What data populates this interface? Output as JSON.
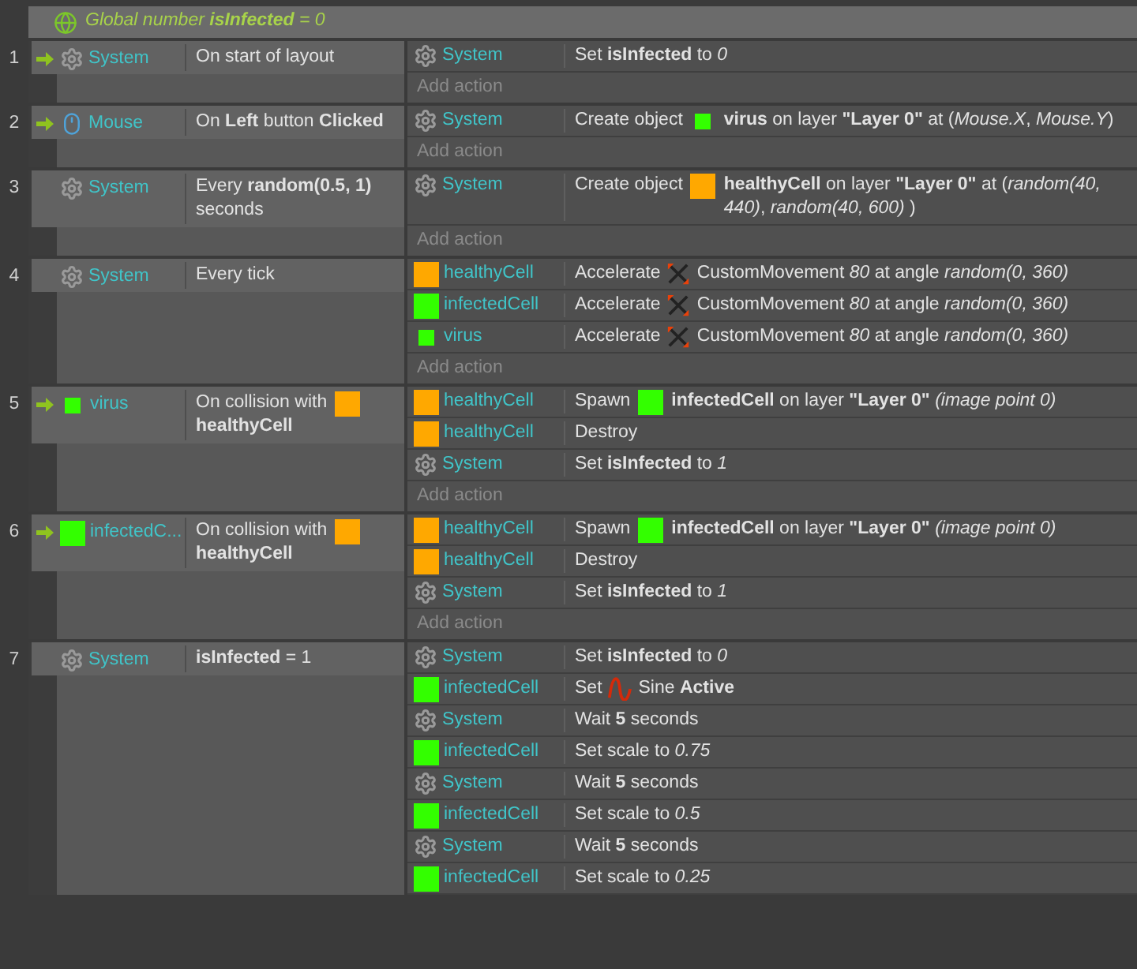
{
  "global_variable": {
    "text": "Global number **isInfected** = 0"
  },
  "events": [
    {
      "number": "1",
      "conditions": [
        {
          "trigger": true,
          "object": {
            "kind": "gear",
            "name": "System"
          },
          "parts": [
            {
              "kind": "text",
              "text": "On start of layout"
            }
          ]
        }
      ],
      "actions": [
        {
          "object": {
            "kind": "gear",
            "name": "System"
          },
          "parts": [
            {
              "kind": "text",
              "text": "Set **isInfected** to *0*"
            }
          ]
        }
      ],
      "add_action": "Add action"
    },
    {
      "number": "2",
      "conditions": [
        {
          "trigger": true,
          "object": {
            "kind": "mouse",
            "name": "Mouse"
          },
          "parts": [
            {
              "kind": "text",
              "text": "On **Left** button **Clicked**"
            }
          ]
        }
      ],
      "actions": [
        {
          "object": {
            "kind": "gear",
            "name": "System"
          },
          "parts": [
            {
              "kind": "text",
              "text": "Create object"
            },
            {
              "kind": "sprite-small",
              "color": "#33ff00"
            },
            {
              "kind": "text",
              "text": "**virus** on layer **\"Layer 0\"** at (*Mouse.X*, *Mouse.Y*)"
            }
          ]
        }
      ],
      "add_action": "Add action"
    },
    {
      "number": "3",
      "conditions": [
        {
          "trigger": false,
          "object": {
            "kind": "gear",
            "name": "System"
          },
          "parts": [
            {
              "kind": "text",
              "text": "Every **random(0.5, 1)** seconds"
            }
          ]
        }
      ],
      "actions": [
        {
          "object": {
            "kind": "gear",
            "name": "System"
          },
          "parts": [
            {
              "kind": "text",
              "text": "Create object"
            },
            {
              "kind": "sprite",
              "color": "#ffa800"
            },
            {
              "kind": "text",
              "text": "**healthyCell** on layer **\"Layer 0\"** at (*random(40, 440)*, *random(40, 600)* )"
            }
          ]
        }
      ],
      "add_action": "Add action"
    },
    {
      "number": "4",
      "conditions": [
        {
          "trigger": false,
          "object": {
            "kind": "gear",
            "name": "System"
          },
          "parts": [
            {
              "kind": "text",
              "text": "Every tick"
            }
          ]
        }
      ],
      "actions": [
        {
          "object": {
            "kind": "sprite",
            "color": "#ffa800",
            "name": "healthyCell"
          },
          "parts": [
            {
              "kind": "text",
              "text": "Accelerate"
            },
            {
              "kind": "movement"
            },
            {
              "kind": "text",
              "text": "CustomMovement *80* at angle *random(0, 360)*"
            }
          ]
        },
        {
          "object": {
            "kind": "sprite",
            "color": "#33ff00",
            "name": "infectedCell"
          },
          "parts": [
            {
              "kind": "text",
              "text": "Accelerate"
            },
            {
              "kind": "movement"
            },
            {
              "kind": "text",
              "text": "CustomMovement *80* at angle *random(0, 360)*"
            }
          ]
        },
        {
          "object": {
            "kind": "sprite-small",
            "color": "#33ff00",
            "name": "virus"
          },
          "parts": [
            {
              "kind": "text",
              "text": "Accelerate"
            },
            {
              "kind": "movement"
            },
            {
              "kind": "text",
              "text": "CustomMovement *80* at angle *random(0, 360)*"
            }
          ]
        }
      ],
      "add_action": "Add action"
    },
    {
      "number": "5",
      "conditions": [
        {
          "trigger": true,
          "object": {
            "kind": "sprite-small",
            "color": "#33ff00",
            "name": "virus"
          },
          "parts": [
            {
              "kind": "text",
              "text": "On collision with"
            },
            {
              "kind": "sprite",
              "color": "#ffa800"
            },
            {
              "kind": "text",
              "text": "**healthyCell**"
            }
          ]
        }
      ],
      "actions": [
        {
          "object": {
            "kind": "sprite",
            "color": "#ffa800",
            "name": "healthyCell"
          },
          "parts": [
            {
              "kind": "text",
              "text": "Spawn"
            },
            {
              "kind": "sprite",
              "color": "#33ff00"
            },
            {
              "kind": "text",
              "text": "**infectedCell** on layer **\"Layer 0\"** *(image point 0)*"
            }
          ]
        },
        {
          "object": {
            "kind": "sprite",
            "color": "#ffa800",
            "name": "healthyCell"
          },
          "parts": [
            {
              "kind": "text",
              "text": "Destroy"
            }
          ]
        },
        {
          "object": {
            "kind": "gear",
            "name": "System"
          },
          "parts": [
            {
              "kind": "text",
              "text": "Set **isInfected** to *1*"
            }
          ]
        }
      ],
      "add_action": "Add action"
    },
    {
      "number": "6",
      "conditions": [
        {
          "trigger": true,
          "object": {
            "kind": "sprite",
            "color": "#33ff00",
            "name": "infectedC..."
          },
          "parts": [
            {
              "kind": "text",
              "text": "On collision with"
            },
            {
              "kind": "sprite",
              "color": "#ffa800"
            },
            {
              "kind": "text",
              "text": "**healthyCell**"
            }
          ]
        }
      ],
      "actions": [
        {
          "object": {
            "kind": "sprite",
            "color": "#ffa800",
            "name": "healthyCell"
          },
          "parts": [
            {
              "kind": "text",
              "text": "Spawn"
            },
            {
              "kind": "sprite",
              "color": "#33ff00"
            },
            {
              "kind": "text",
              "text": "**infectedCell** on layer **\"Layer 0\"** *(image point 0)*"
            }
          ]
        },
        {
          "object": {
            "kind": "sprite",
            "color": "#ffa800",
            "name": "healthyCell"
          },
          "parts": [
            {
              "kind": "text",
              "text": "Destroy"
            }
          ]
        },
        {
          "object": {
            "kind": "gear",
            "name": "System"
          },
          "parts": [
            {
              "kind": "text",
              "text": "Set **isInfected** to *1*"
            }
          ]
        }
      ],
      "add_action": "Add action"
    },
    {
      "number": "7",
      "conditions": [
        {
          "trigger": false,
          "object": {
            "kind": "gear",
            "name": "System"
          },
          "parts": [
            {
              "kind": "text",
              "text": "**isInfected** = 1"
            }
          ]
        }
      ],
      "actions": [
        {
          "object": {
            "kind": "gear",
            "name": "System"
          },
          "parts": [
            {
              "kind": "text",
              "text": "Set **isInfected** to *0*"
            }
          ]
        },
        {
          "object": {
            "kind": "sprite",
            "color": "#33ff00",
            "name": "infectedCell"
          },
          "parts": [
            {
              "kind": "text",
              "text": "Set"
            },
            {
              "kind": "sine"
            },
            {
              "kind": "text",
              "text": "Sine **Active**"
            }
          ]
        },
        {
          "object": {
            "kind": "gear",
            "name": "System"
          },
          "parts": [
            {
              "kind": "text",
              "text": "Wait **5** seconds"
            }
          ]
        },
        {
          "object": {
            "kind": "sprite",
            "color": "#33ff00",
            "name": "infectedCell"
          },
          "parts": [
            {
              "kind": "text",
              "text": "Set scale to *0.75*"
            }
          ]
        },
        {
          "object": {
            "kind": "gear",
            "name": "System"
          },
          "parts": [
            {
              "kind": "text",
              "text": "Wait **5** seconds"
            }
          ]
        },
        {
          "object": {
            "kind": "sprite",
            "color": "#33ff00",
            "name": "infectedCell"
          },
          "parts": [
            {
              "kind": "text",
              "text": "Set scale to *0.5*"
            }
          ]
        },
        {
          "object": {
            "kind": "gear",
            "name": "System"
          },
          "parts": [
            {
              "kind": "text",
              "text": "Wait **5** seconds"
            }
          ]
        },
        {
          "object": {
            "kind": "sprite",
            "color": "#33ff00",
            "name": "infectedCell"
          },
          "parts": [
            {
              "kind": "text",
              "text": "Set scale to *0.25*"
            }
          ]
        }
      ]
    }
  ]
}
